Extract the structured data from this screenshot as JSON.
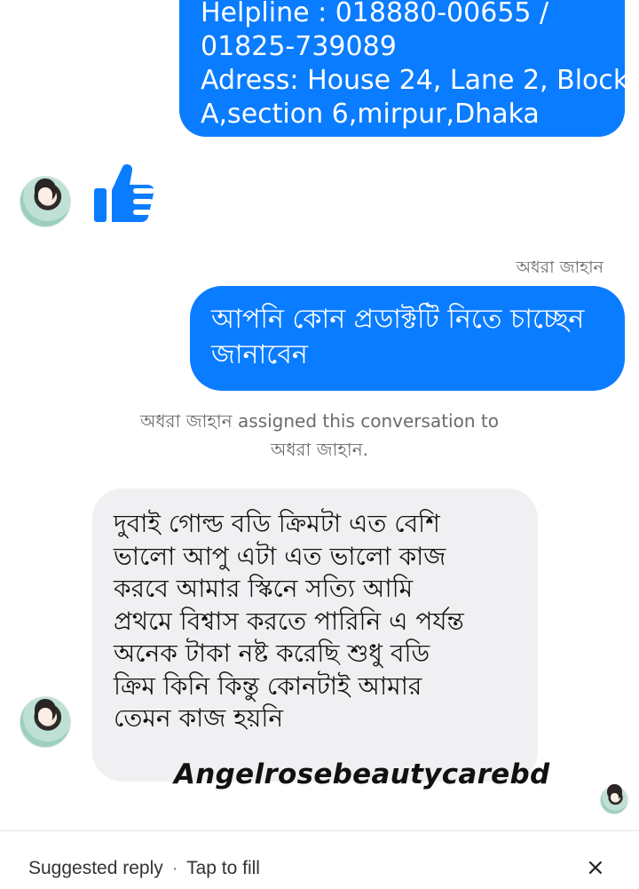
{
  "messages": {
    "top_bubble": {
      "lines": [
        "Helpline : 018880-00655 /",
        "01825-739089",
        "Adress: House 24, Lane 2, Block",
        "A,section 6,mirpur,Dhaka"
      ]
    },
    "like_icon": "thumbs-up-icon",
    "sender_name": "অধরা জাহান",
    "outgoing_question": "আপনি কোন প্রডাক্টটি নিতে চাচ্ছেন জানাবেন",
    "system_notice": {
      "line1": "অধরা জাহান assigned this conversation to",
      "line2": "অধরা জাহান."
    },
    "incoming_review": {
      "lines": [
        "দুবাই গোল্ড বডি ক্রিমটা এত বেশি",
        "ভালো আপু এটা এত ভালো কাজ",
        "করবে আমার স্কিনে সত্যি আমি",
        "প্রথমে বিশ্বাস করতে পারিনি এ পর্যন্ত",
        "অনেক টাকা নষ্ট করেছি শুধু বডি",
        "ক্রিম কিনি কিন্তু কোনটাই আমার",
        "তেমন কাজ হয়নি"
      ]
    },
    "watermark": "Angelrosebeautycarebd"
  },
  "footer": {
    "suggested_reply": "Suggested reply",
    "separator": "·",
    "tap_to_fill": "Tap to fill",
    "close_label": "×"
  },
  "colors": {
    "outgoing_bubble": "#0a7cff",
    "incoming_bubble": "#f0f0f3",
    "like_icon": "#0a7cff"
  }
}
